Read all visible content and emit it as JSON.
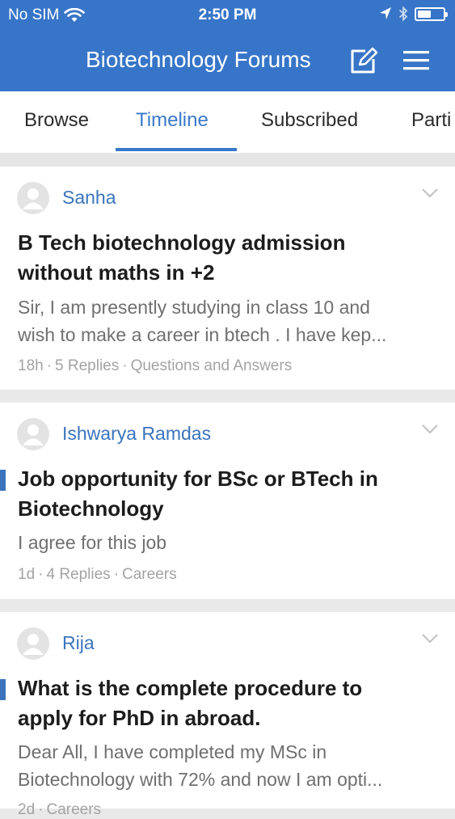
{
  "status_bar": {
    "carrier": "No SIM",
    "time": "2:50 PM"
  },
  "header": {
    "title": "Biotechnology Forums",
    "compose_icon": "compose-icon",
    "menu_icon": "hamburger-menu-icon",
    "background_color": "#3775c8"
  },
  "tabs": [
    {
      "label": "Browse"
    },
    {
      "label": "Timeline",
      "active": true
    },
    {
      "label": "Subscribed"
    },
    {
      "label": "Parti"
    }
  ],
  "accent_color": "#3a78c9",
  "posts": [
    {
      "author": "Sanha",
      "title_lines": [
        "B Tech biotechnology admission",
        "without maths in +2"
      ],
      "excerpt_lines": [
        "Sir, I am presently studying in class 10 and",
        "wish to make a career in btech . I have kep..."
      ],
      "age": "18h",
      "replies": "5 Replies",
      "category": "Questions and Answers",
      "unread": false
    },
    {
      "author": "Ishwarya Ramdas",
      "title_lines": [
        "Job opportunity for BSc or BTech in",
        "Biotechnology"
      ],
      "excerpt_lines": [
        "I agree for this job"
      ],
      "age": "1d",
      "replies": "4 Replies",
      "category": "Careers",
      "unread": true
    },
    {
      "author": "Rija",
      "title_lines": [
        "What is the complete procedure to",
        "apply for PhD in abroad."
      ],
      "excerpt_lines": [
        "Dear All, I have completed my MSc in",
        "Biotechnology with 72% and now I am opti..."
      ],
      "age": "2d",
      "replies": "",
      "category": "Careers",
      "unread": true
    }
  ]
}
